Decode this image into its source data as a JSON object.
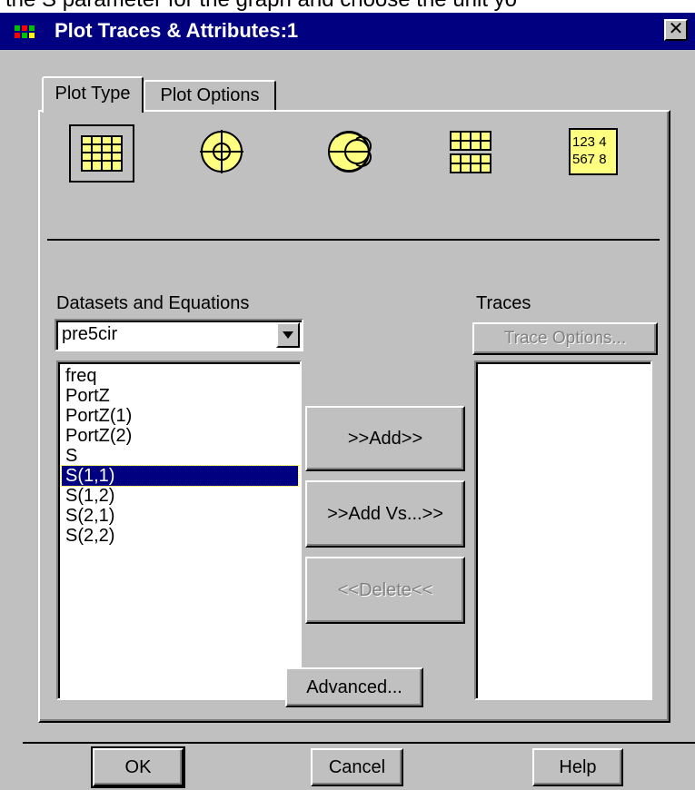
{
  "caption": "the S parameter for the graph and choose the unit yo",
  "window": {
    "title": "Plot Traces & Attributes:1",
    "close_glyph": "✕"
  },
  "tabs": [
    {
      "label": "Plot Type"
    },
    {
      "label": "Plot Options"
    }
  ],
  "plot_types": [
    {
      "icon": "rectangular-grid-plot-icon",
      "label": ""
    },
    {
      "icon": "polar-plot-icon",
      "label": ""
    },
    {
      "icon": "smith-chart-icon",
      "label": ""
    },
    {
      "icon": "stacked-grid-plot-icon",
      "label": ""
    },
    {
      "icon": "data-list-icon",
      "label": "123 4 567 8",
      "line1": "123 4",
      "line2": "567 8"
    }
  ],
  "datasets": {
    "label": "Datasets and Equations",
    "selected_dataset": "pre5cir",
    "items": [
      "freq",
      "PortZ",
      "PortZ(1)",
      "PortZ(2)",
      "S",
      "S(1,1)",
      "S(1,2)",
      "S(2,1)",
      "S(2,2)"
    ],
    "selected_item": "S(1,1)"
  },
  "traces": {
    "label": "Traces",
    "options_button": "Trace Options...",
    "items": []
  },
  "actions": {
    "add": ">>Add>>",
    "add_vs": ">>Add Vs...>>",
    "delete": "<<Delete<<",
    "advanced": "Advanced..."
  },
  "footer": {
    "ok": "OK",
    "cancel": "Cancel",
    "help": "Help"
  },
  "colors": {
    "titlebar": "#000080",
    "icon_fill": "#ffff80",
    "selection": "#000080",
    "face": "#c0c0c0"
  }
}
